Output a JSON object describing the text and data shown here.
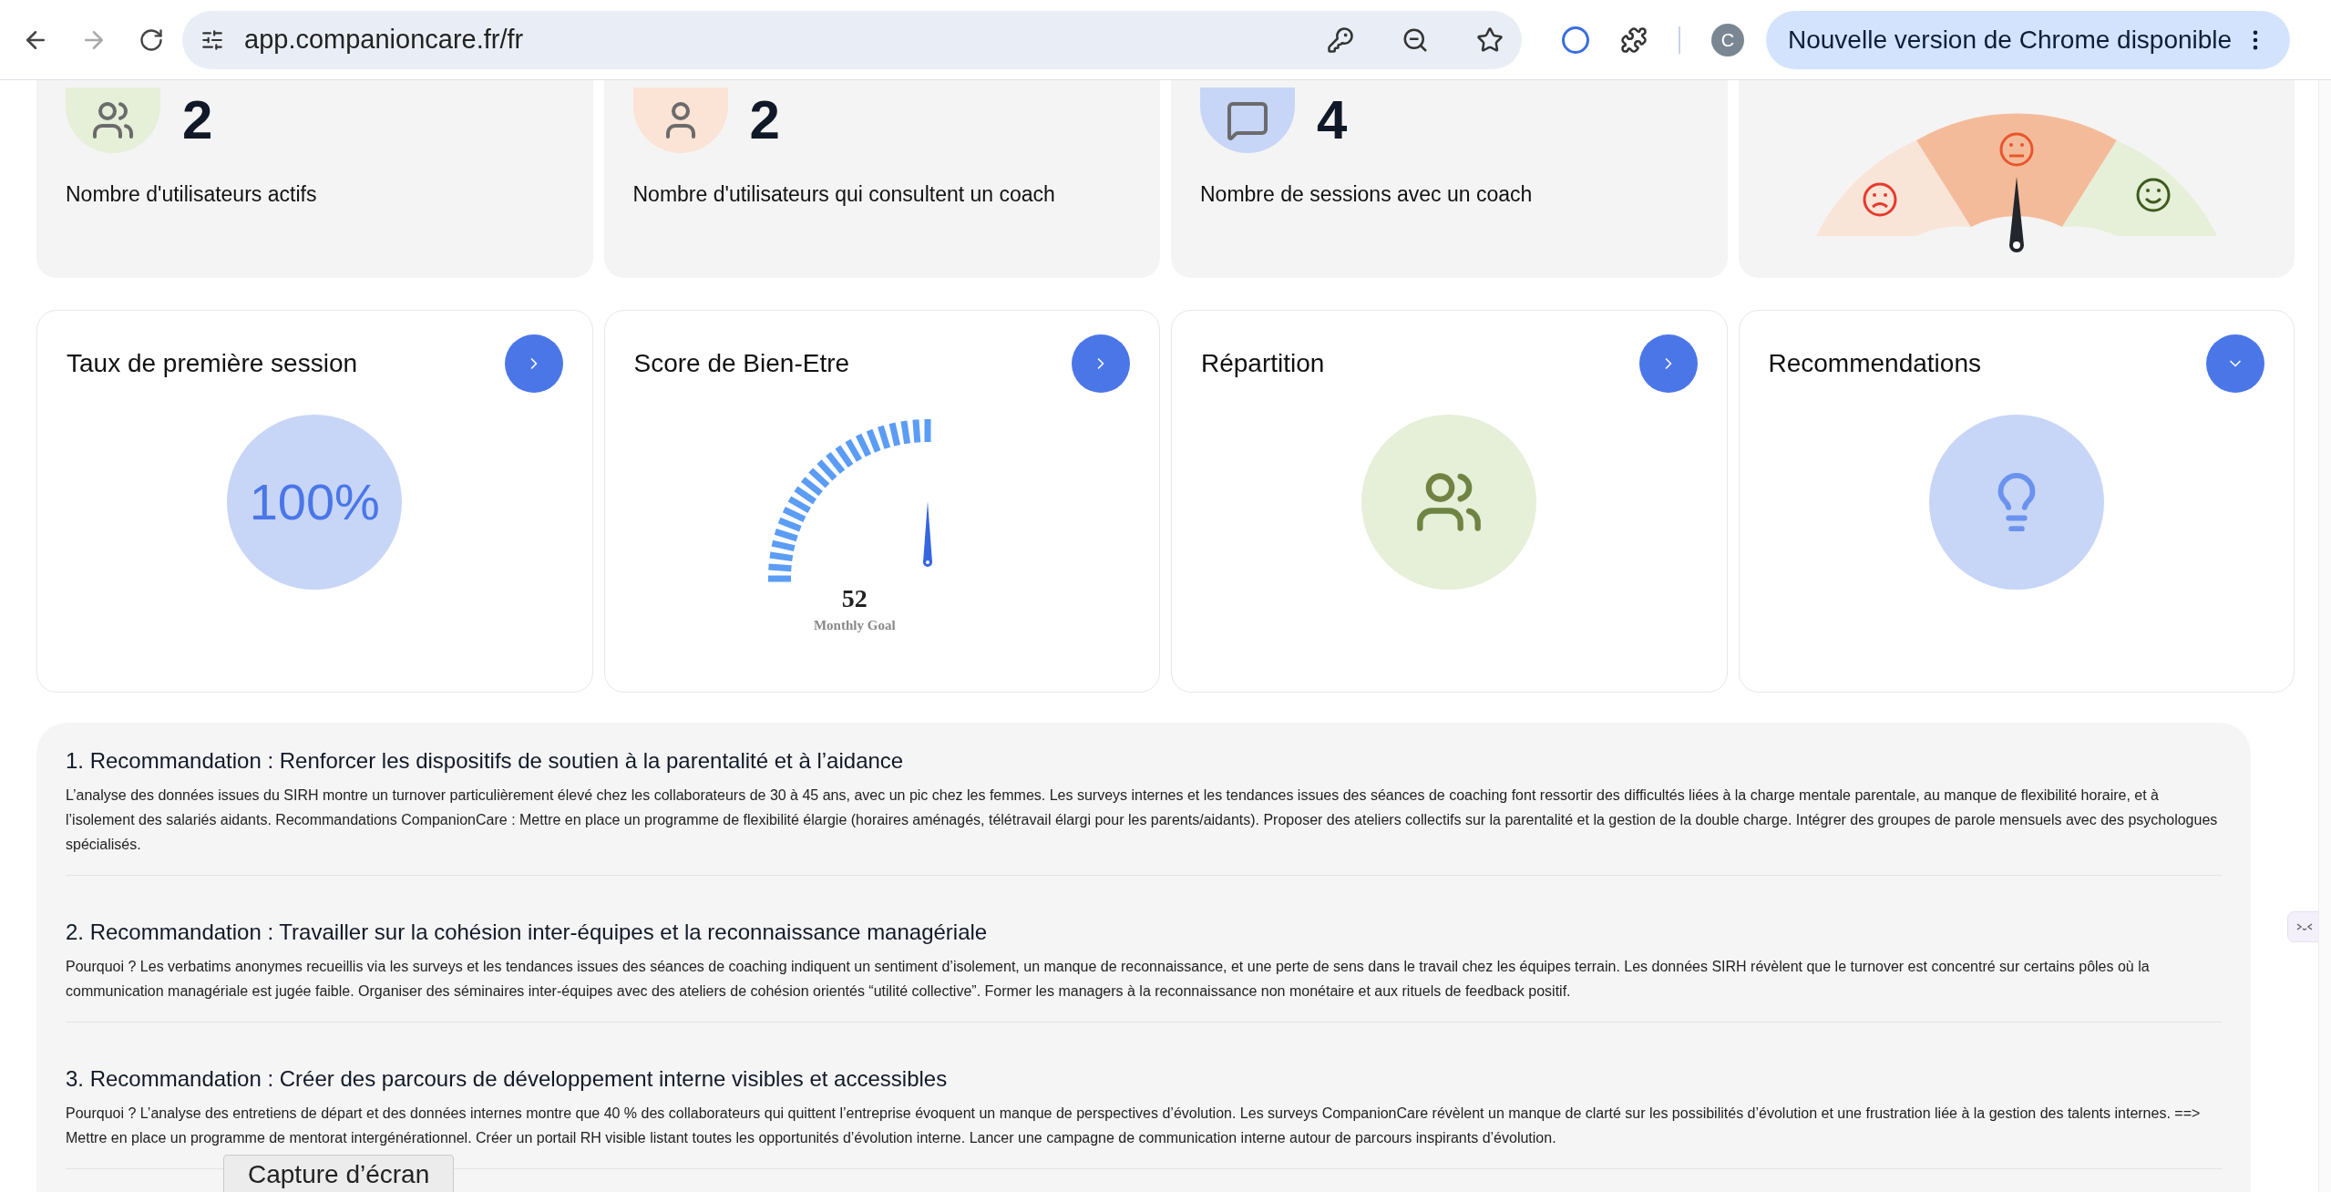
{
  "browser": {
    "url": "app.companioncare.fr/fr",
    "profile_initial": "C",
    "update_button": "Nouvelle version de Chrome disponible"
  },
  "stat_cards": [
    {
      "kind": "users",
      "value": "2",
      "label": "Nombre d'utilisateurs actifs",
      "color": "#e6efd8"
    },
    {
      "kind": "person",
      "value": "2",
      "label": "Nombre d'utilisateurs qui consultent un coach",
      "color": "#fbe3d5"
    },
    {
      "kind": "chat",
      "value": "4",
      "label": "Nombre de sessions avec un coach",
      "color": "#c7d5f7"
    }
  ],
  "feature_cards": [
    {
      "kind": "percent",
      "title": "Taux de première session",
      "expanded": false,
      "value": "100%"
    },
    {
      "kind": "gauge",
      "title": "Score de Bien-Etre",
      "expanded": false,
      "value": "52",
      "caption": "Monthly Goal"
    },
    {
      "kind": "people",
      "title": "Répartition",
      "expanded": false
    },
    {
      "kind": "idea",
      "title": "Recommendations",
      "expanded": true
    }
  ],
  "recommendations": [
    {
      "title": "1. Recommandation : Renforcer les dispositifs de soutien à la parentalité et à l’aidance",
      "text": "L’analyse des données issues du SIRH montre un turnover particulièrement élevé chez les collaborateurs de 30 à 45 ans, avec un pic chez les femmes. Les surveys internes et les tendances issues des séances de coaching font ressortir des difficultés liées à la charge mentale parentale, au manque de flexibilité horaire, et à l’isolement des salariés aidants. Recommandations CompanionCare : Mettre en place un programme de flexibilité élargie (horaires aménagés, télétravail élargi pour les parents/aidants). Proposer des ateliers collectifs sur la parentalité et la gestion de la double charge. Intégrer des groupes de parole mensuels avec des psychologues spécialisés."
    },
    {
      "title": "2. Recommandation : Travailler sur la cohésion inter-équipes et la reconnaissance managériale",
      "text": "Pourquoi ? Les verbatims anonymes recueillis via les surveys et les tendances issues des séances de coaching indiquent un sentiment d’isolement, un manque de reconnaissance, et une perte de sens dans le travail chez les équipes terrain. Les données SIRH révèlent que le turnover est concentré sur certains pôles où la communication managériale est jugée faible. Organiser des séminaires inter-équipes avec des ateliers de cohésion orientés “utilité collective”. Former les managers à la reconnaissance non monétaire et aux rituels de feedback positif."
    },
    {
      "title": "3. Recommandation : Créer des parcours de développement interne visibles et accessibles",
      "text": "Pourquoi ? L’analyse des entretiens de départ et des données internes montre que 40 % des collaborateurs qui quittent l’entreprise évoquent un manque de perspectives d’évolution. Les surveys CompanionCare révèlent un manque de clarté sur les possibilités d’évolution et une frustration liée à la gestion des talents internes. ==> Mettre en place un programme de mentorat intergénérationnel. Créer un portail RH visible listant toutes les opportunités d’évolution interne. Lancer une campagne de communication interne autour de parcours inspirants d’évolution."
    }
  ],
  "tooltip": "Capture d’écran"
}
